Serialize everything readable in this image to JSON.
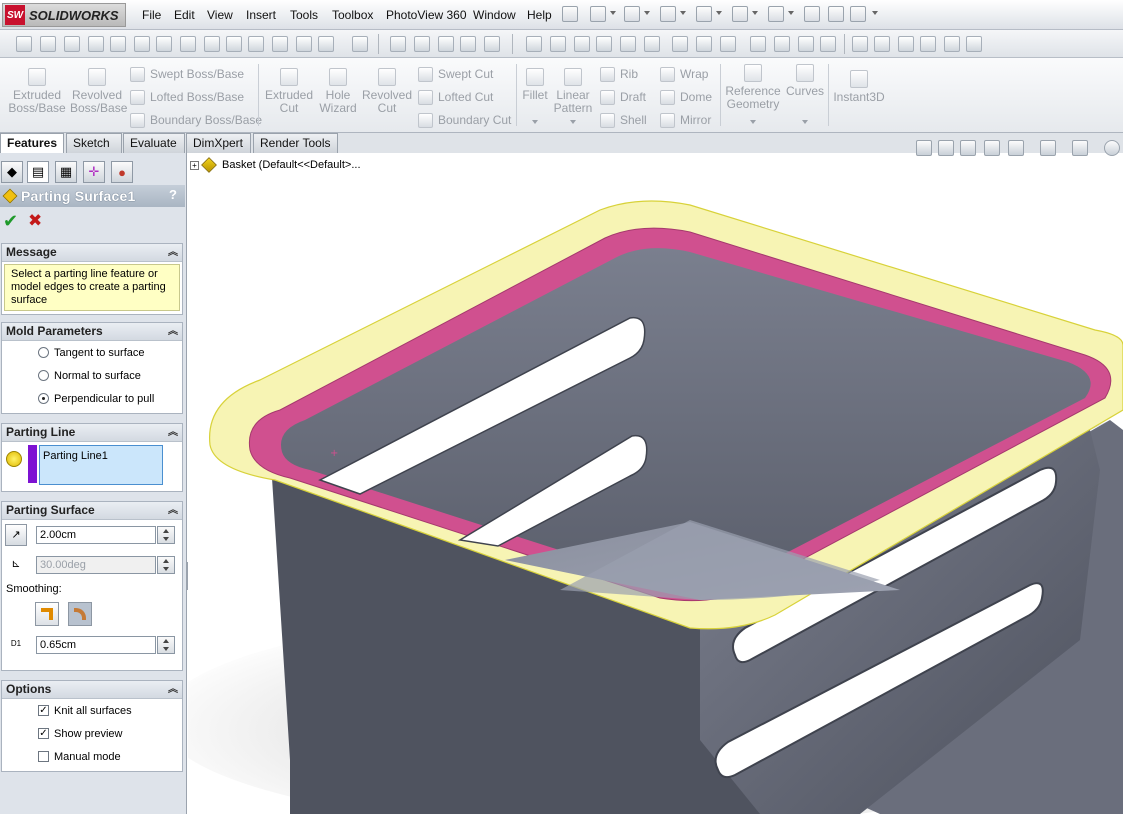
{
  "app": {
    "logo_mark": "SW",
    "logo_text": "SOLIDWORKS"
  },
  "menu": [
    "File",
    "Edit",
    "View",
    "Insert",
    "Tools",
    "Toolbox",
    "PhotoView 360",
    "Window",
    "Help"
  ],
  "command_manager": {
    "extruded_boss": "Extruded Boss/Base",
    "revolved_boss": "Revolved Boss/Base",
    "swept_boss": "Swept Boss/Base",
    "lofted_boss": "Lofted Boss/Base",
    "boundary_boss": "Boundary Boss/Base",
    "extruded_cut": "Extruded Cut",
    "hole_wizard": "Hole Wizard",
    "revolved_cut": "Revolved Cut",
    "swept_cut": "Swept Cut",
    "lofted_cut": "Lofted Cut",
    "boundary_cut": "Boundary Cut",
    "fillet": "Fillet",
    "linear_pattern": "Linear Pattern",
    "rib": "Rib",
    "draft": "Draft",
    "shell": "Shell",
    "wrap": "Wrap",
    "dome": "Dome",
    "mirror": "Mirror",
    "reference_geometry": "Reference Geometry",
    "curves": "Curves",
    "instant3d": "Instant3D"
  },
  "tabs": [
    "Features",
    "Sketch",
    "Evaluate",
    "DimXpert",
    "Render Tools"
  ],
  "property_manager": {
    "title": "Parting Surface1",
    "help": "?",
    "message": {
      "header": "Message",
      "text": "Select a parting line feature or model edges to create a parting surface"
    },
    "mold_parameters": {
      "header": "Mold Parameters",
      "options": [
        {
          "label": "Tangent to surface",
          "selected": false
        },
        {
          "label": "Normal to surface",
          "selected": false
        },
        {
          "label": "Perpendicular to pull",
          "selected": true
        }
      ]
    },
    "parting_line": {
      "header": "Parting Line",
      "item": "Parting Line1"
    },
    "parting_surface": {
      "header": "Parting Surface",
      "distance": "2.00cm",
      "angle": "30.00deg",
      "smoothing_label": "Smoothing:",
      "smoothing_distance": "0.65cm",
      "d1_label": "D1"
    },
    "options": {
      "header": "Options",
      "items": [
        {
          "label": "Knit all surfaces",
          "checked": true
        },
        {
          "label": "Show preview",
          "checked": true
        },
        {
          "label": "Manual mode",
          "checked": false
        }
      ]
    }
  },
  "tree": {
    "root": "Basket  (Default<<Default>..."
  },
  "colors": {
    "accent_purple": "#7d12d2",
    "parting_pink": "#d0508f",
    "preview_yellow": "#f4f1a0",
    "model_gray": "#6c7180"
  }
}
